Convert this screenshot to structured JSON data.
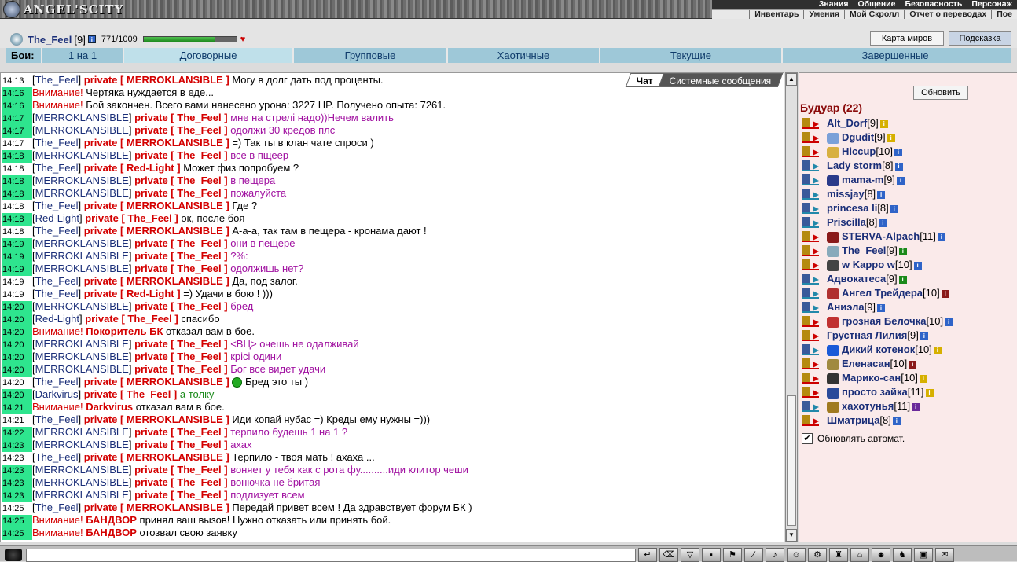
{
  "app": {
    "logo": "ANGEL'SCITY"
  },
  "menu": {
    "row1": [
      "Знания",
      "Общение",
      "Безопасность",
      "Персонаж"
    ],
    "row2": [
      "Инвентарь",
      "Умения",
      "Мой Скролл",
      "Отчет о переводах",
      "Пое"
    ]
  },
  "user": {
    "name": "The_Feel",
    "level": "[9]",
    "hp": "771/1009",
    "hp_fraction": 0.764
  },
  "header_buttons": {
    "map": "Карта миров",
    "hint": "Подсказка"
  },
  "battle_tabs": {
    "label": "Бои:",
    "items": [
      "1 на 1",
      "Договорные",
      "Групповые",
      "Хаотичные",
      "Текущие",
      "Завершенные"
    ],
    "active": 1
  },
  "chat_tabs": {
    "chat": "Чат",
    "system": "Системные сообщения"
  },
  "chat": [
    {
      "t": "14:13",
      "hl": false,
      "type": "priv",
      "from": "The_Feel",
      "to": "MERROKLANSIBLE",
      "msg": "Могу в долг дать под проценты."
    },
    {
      "t": "14:16",
      "hl": true,
      "type": "warn",
      "pre": "Внимание!",
      "msg": "Чертяка нуждается в еде..."
    },
    {
      "t": "14:16",
      "hl": true,
      "type": "warn",
      "pre": "Внимание!",
      "msg": "Бой закончен. Всего вами нанесено урона: 3227 HP. Получено опыта: 7261."
    },
    {
      "t": "14:17",
      "hl": true,
      "type": "priv",
      "from": "MERROKLANSIBLE",
      "to": "The_Feel",
      "msg": "мне на стрелі надо))Нечем валить"
    },
    {
      "t": "14:17",
      "hl": true,
      "type": "priv",
      "from": "MERROKLANSIBLE",
      "to": "The_Feel",
      "msg": "одолжи 30 кредов плс"
    },
    {
      "t": "14:17",
      "hl": false,
      "type": "priv",
      "from": "The_Feel",
      "to": "MERROKLANSIBLE",
      "msg": "=) Так ты в клан чате спроси )"
    },
    {
      "t": "14:18",
      "hl": true,
      "type": "priv",
      "from": "MERROKLANSIBLE",
      "to": "The_Feel",
      "msg": "все в пщеер"
    },
    {
      "t": "14:18",
      "hl": false,
      "type": "priv",
      "from": "The_Feel",
      "to": "Red-Light",
      "msg": "Может физ попробуем ?"
    },
    {
      "t": "14:18",
      "hl": true,
      "type": "priv",
      "from": "MERROKLANSIBLE",
      "to": "The_Feel",
      "msg": "в пещера"
    },
    {
      "t": "14:18",
      "hl": true,
      "type": "priv",
      "from": "MERROKLANSIBLE",
      "to": "The_Feel",
      "msg": "пожалуйста"
    },
    {
      "t": "14:18",
      "hl": false,
      "type": "priv",
      "from": "The_Feel",
      "to": "MERROKLANSIBLE",
      "msg": "Где ?"
    },
    {
      "t": "14:18",
      "hl": true,
      "type": "priv",
      "from": "Red-Light",
      "to": "The_Feel",
      "msg": "ок, после боя"
    },
    {
      "t": "14:18",
      "hl": false,
      "type": "priv",
      "from": "The_Feel",
      "to": "MERROKLANSIBLE",
      "msg": "А-а-а, так там в пещера - кронама дают !"
    },
    {
      "t": "14:19",
      "hl": true,
      "type": "priv",
      "from": "MERROKLANSIBLE",
      "to": "The_Feel",
      "msg": "они в пещере"
    },
    {
      "t": "14:19",
      "hl": true,
      "type": "priv",
      "from": "MERROKLANSIBLE",
      "to": "The_Feel",
      "msg": "?%:"
    },
    {
      "t": "14:19",
      "hl": true,
      "type": "priv",
      "from": "MERROKLANSIBLE",
      "to": "The_Feel",
      "msg": "одолжишь нет?"
    },
    {
      "t": "14:19",
      "hl": false,
      "type": "priv",
      "from": "The_Feel",
      "to": "MERROKLANSIBLE",
      "msg": "Да, под залог."
    },
    {
      "t": "14:19",
      "hl": false,
      "type": "priv",
      "from": "The_Feel",
      "to": "Red-Light",
      "msg": "=) Удачи в бою ! )))"
    },
    {
      "t": "14:20",
      "hl": true,
      "type": "priv",
      "from": "MERROKLANSIBLE",
      "to": "The_Feel",
      "msg": "бред"
    },
    {
      "t": "14:20",
      "hl": true,
      "type": "priv",
      "from": "Red-Light",
      "to": "The_Feel",
      "msg": "спасибо"
    },
    {
      "t": "14:20",
      "hl": true,
      "type": "warn",
      "pre": "Внимание!",
      "who": "Покоритель БК",
      "msg": "отказал вам в бое."
    },
    {
      "t": "14:20",
      "hl": true,
      "type": "priv",
      "from": "MERROKLANSIBLE",
      "to": "The_Feel",
      "msg": "<ВЦ> очешь не одалживай"
    },
    {
      "t": "14:20",
      "hl": true,
      "type": "priv",
      "from": "MERROKLANSIBLE",
      "to": "The_Feel",
      "msg": "крісі одини"
    },
    {
      "t": "14:20",
      "hl": true,
      "type": "priv",
      "from": "MERROKLANSIBLE",
      "to": "The_Feel",
      "msg": "Бог все видет удачи"
    },
    {
      "t": "14:20",
      "hl": false,
      "type": "priv",
      "from": "The_Feel",
      "to": "MERROKLANSIBLE",
      "msg": "Бред это ты )",
      "smile": true
    },
    {
      "t": "14:20",
      "hl": true,
      "type": "priv",
      "from": "Darkvirus",
      "to": "The_Feel",
      "msg": "а толку",
      "green": true
    },
    {
      "t": "14:21",
      "hl": true,
      "type": "warn",
      "pre": "Внимание!",
      "who": "Darkvirus",
      "msg": "отказал вам в бое."
    },
    {
      "t": "14:21",
      "hl": false,
      "type": "priv",
      "from": "The_Feel",
      "to": "MERROKLANSIBLE",
      "msg": "Иди копай нубас =) Креды ему нужны =)))"
    },
    {
      "t": "14:22",
      "hl": true,
      "type": "priv",
      "from": "MERROKLANSIBLE",
      "to": "The_Feel",
      "msg": "терпило будешь 1 на 1 ?"
    },
    {
      "t": "14:23",
      "hl": true,
      "type": "priv",
      "from": "MERROKLANSIBLE",
      "to": "The_Feel",
      "msg": "ахах"
    },
    {
      "t": "14:23",
      "hl": false,
      "type": "priv",
      "from": "The_Feel",
      "to": "MERROKLANSIBLE",
      "msg": "Терпило - твоя мать ! ахаха ..."
    },
    {
      "t": "14:23",
      "hl": true,
      "type": "priv",
      "from": "MERROKLANSIBLE",
      "to": "The_Feel",
      "msg": "воняет у тебя как с рота фу..........иди клитор чеши"
    },
    {
      "t": "14:23",
      "hl": true,
      "type": "priv",
      "from": "MERROKLANSIBLE",
      "to": "The_Feel",
      "msg": "вонючка не бритая"
    },
    {
      "t": "14:23",
      "hl": true,
      "type": "priv",
      "from": "MERROKLANSIBLE",
      "to": "The_Feel",
      "msg": "подлизует всем"
    },
    {
      "t": "14:25",
      "hl": false,
      "type": "priv",
      "from": "The_Feel",
      "to": "MERROKLANSIBLE",
      "msg": "Передай привет всем ! Да здравствует форум БК )"
    },
    {
      "t": "14:25",
      "hl": true,
      "type": "warn",
      "pre": "Внимание!",
      "who": "БАНДВОР",
      "msg": "принял ваш вызов! Нужно отказать или принять бой."
    },
    {
      "t": "14:25",
      "hl": true,
      "type": "warn",
      "pre": "Внимание!",
      "who": "БАНДВОР",
      "msg": "отозвал свою заявку"
    }
  ],
  "side": {
    "refresh": "Обновить",
    "room": "Будуар (22)",
    "auto_label": "Обновлять автомат.",
    "auto_checked": "✔",
    "users": [
      {
        "n": "Alt_Dorf",
        "lv": "[9]",
        "ic": "r",
        "info": "#d6b000"
      },
      {
        "n": "Dgudit",
        "lv": "[9]",
        "ic": "r",
        "info": "#d6b000",
        "clan": "#7aa0d8"
      },
      {
        "n": "Hiccup",
        "lv": "[10]",
        "ic": "r",
        "info": "#2f64c8",
        "clan": "#d8b040"
      },
      {
        "n": "Lady storm",
        "lv": "[8]",
        "ic": "b",
        "info": "#2f64c8"
      },
      {
        "n": "mama-m",
        "lv": "[9]",
        "ic": "b",
        "info": "#2f64c8",
        "clan": "#2a3a8a"
      },
      {
        "n": "missjay",
        "lv": "[8]",
        "ic": "b",
        "info": "#2f64c8"
      },
      {
        "n": "princesa li",
        "lv": "[8]",
        "ic": "b",
        "info": "#2f64c8"
      },
      {
        "n": "Priscilla",
        "lv": "[8]",
        "ic": "b",
        "info": "#2f64c8"
      },
      {
        "n": "STERVA-Alpach",
        "lv": "[11]",
        "ic": "r",
        "info": "#2f64c8",
        "clan": "#8a1a1a"
      },
      {
        "n": "The_Feel",
        "lv": "[9]",
        "ic": "r",
        "info": "#1a8a1a",
        "clan": "#8ab"
      },
      {
        "n": "w Kappo w",
        "lv": "[10]",
        "ic": "r",
        "info": "#2f64c8",
        "clan": "#444"
      },
      {
        "n": "Адвокатеса",
        "lv": "[9]",
        "ic": "b",
        "info": "#1a8a1a"
      },
      {
        "n": "Ангел Трейдера",
        "lv": "[10]",
        "ic": "b",
        "info": "#8a1a1a",
        "clan": "#b03030"
      },
      {
        "n": "Аниэла",
        "lv": "[9]",
        "ic": "b",
        "info": "#2f64c8"
      },
      {
        "n": "грозная Белочка",
        "lv": "[10]",
        "ic": "r",
        "info": "#2f64c8",
        "clan": "#c03030"
      },
      {
        "n": "Грустная Лилия",
        "lv": "[9]",
        "ic": "r",
        "info": "#2f64c8"
      },
      {
        "n": "Дикий котенок",
        "lv": "[10]",
        "ic": "b",
        "info": "#d6b000",
        "clan": "#1a5ad8"
      },
      {
        "n": "Еленасан",
        "lv": "[10]",
        "ic": "r",
        "info": "#8a1a1a",
        "clan": "#a08a40"
      },
      {
        "n": "Марико-сан",
        "lv": "[10]",
        "ic": "r",
        "info": "#d6b000",
        "clan": "#333"
      },
      {
        "n": "просто зайка",
        "lv": "[11]",
        "ic": "r",
        "info": "#d6b000",
        "clan": "#2a4a9a"
      },
      {
        "n": "хахотунья",
        "lv": "[11]",
        "ic": "b",
        "info": "#6a2a9a",
        "clan": "#a07a20"
      },
      {
        "n": "Шматрица",
        "lv": "[8]",
        "ic": "r",
        "info": "#2f64c8"
      }
    ]
  }
}
